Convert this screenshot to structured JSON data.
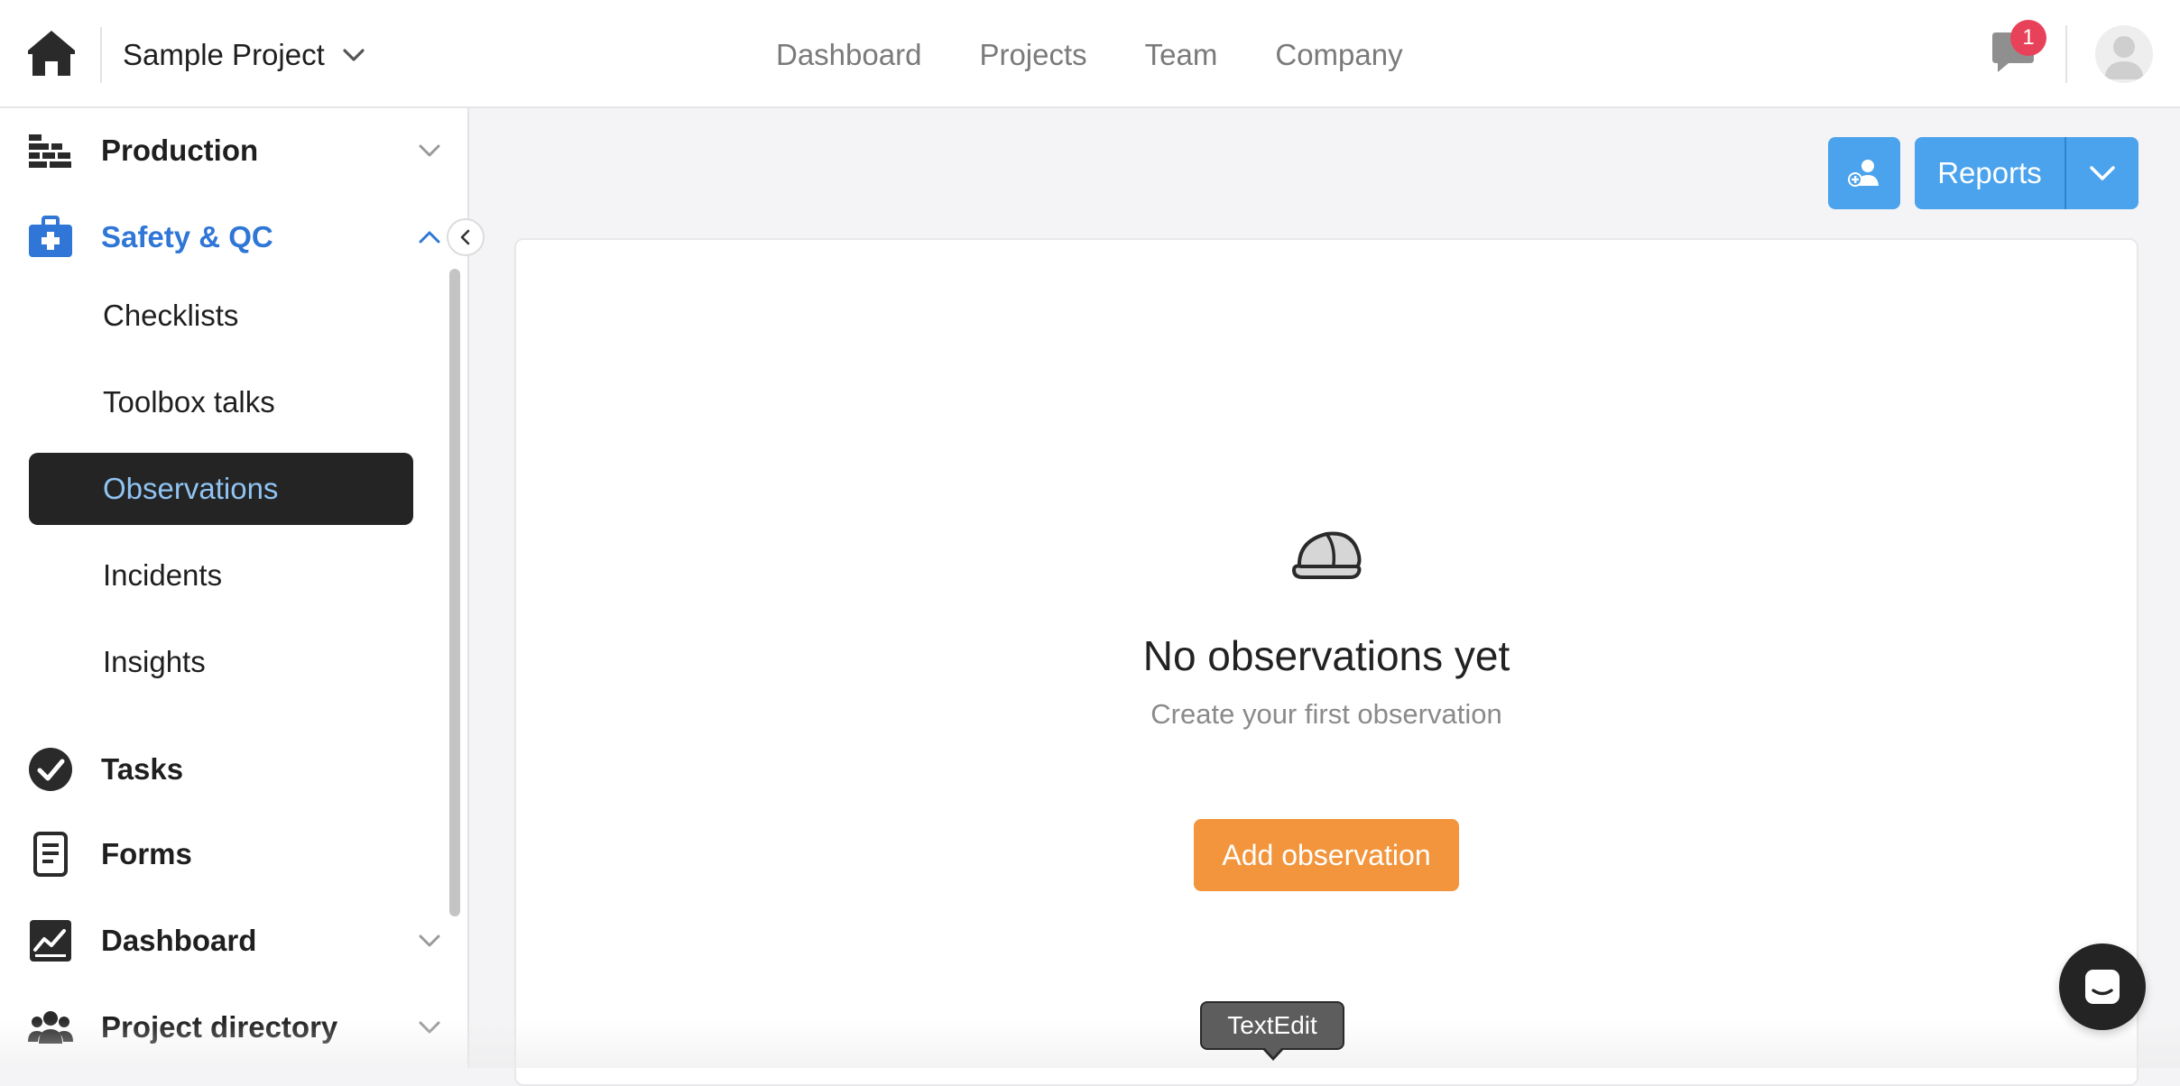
{
  "header": {
    "project_name": "Sample Project",
    "nav": [
      "Dashboard",
      "Projects",
      "Team",
      "Company"
    ],
    "notification_count": "1"
  },
  "sidebar": {
    "groups": {
      "production": "Production",
      "safety": "Safety & QC",
      "tasks": "Tasks",
      "forms": "Forms",
      "dashboard": "Dashboard",
      "directory": "Project directory"
    },
    "safety_items": [
      "Checklists",
      "Toolbox talks",
      "Observations",
      "Incidents",
      "Insights"
    ],
    "selected_item": "Observations"
  },
  "toolbar": {
    "reports_label": "Reports"
  },
  "empty_state": {
    "title": "No observations yet",
    "subtitle": "Create your first observation",
    "button_label": "Add observation"
  },
  "tooltip": {
    "label": "TextEdit"
  },
  "colors": {
    "accent_blue": "#4aa3ec",
    "active_blue": "#2f76d6",
    "orange": "#f2953c",
    "badge_red": "#e8425a",
    "dark": "#242424"
  }
}
